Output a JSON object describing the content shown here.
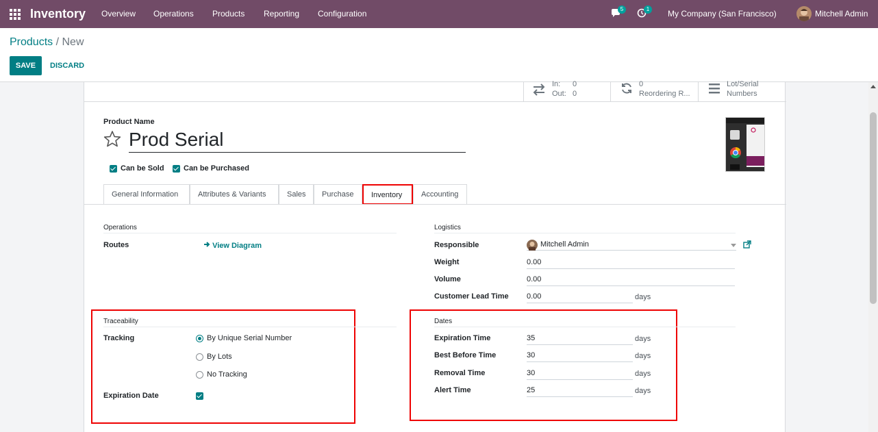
{
  "navbar": {
    "app_name": "Inventory",
    "menu": [
      "Overview",
      "Operations",
      "Products",
      "Reporting",
      "Configuration"
    ],
    "messages_count": "5",
    "activities_count": "1",
    "company": "My Company (San Francisco)",
    "user": "Mitchell Admin",
    "color": "#714b67"
  },
  "breadcrumb": {
    "parent": "Products",
    "separator": "/",
    "current": "New"
  },
  "buttons": {
    "save": "SAVE",
    "discard": "DISCARD"
  },
  "smart_buttons": {
    "in_label": "In:",
    "in_value": "0",
    "out_label": "Out:",
    "out_value": "0",
    "reordering_value": "0",
    "reordering_label": "Reordering R...",
    "lot_label_1": "Lot/Serial",
    "lot_label_2": "Numbers"
  },
  "product": {
    "name_label": "Product Name",
    "name": "Prod Serial",
    "can_be_sold": "Can be Sold",
    "can_be_purchased": "Can be Purchased"
  },
  "tabs": [
    "General Information",
    "Attributes & Variants",
    "Sales",
    "Purchase",
    "Inventory",
    "Accounting"
  ],
  "active_tab": "Inventory",
  "operations": {
    "title": "Operations",
    "routes_label": "Routes",
    "view_diagram": "View Diagram"
  },
  "logistics": {
    "title": "Logistics",
    "responsible_label": "Responsible",
    "responsible_value": "Mitchell Admin",
    "weight_label": "Weight",
    "weight_value": "0.00",
    "volume_label": "Volume",
    "volume_value": "0.00",
    "lead_label": "Customer Lead Time",
    "lead_value": "0.00",
    "lead_unit": "days"
  },
  "traceability": {
    "title": "Traceability",
    "tracking_label": "Tracking",
    "options": [
      "By Unique Serial Number",
      "By Lots",
      "No Tracking"
    ],
    "selected": "By Unique Serial Number",
    "expiration_label": "Expiration Date"
  },
  "dates": {
    "title": "Dates",
    "rows": [
      {
        "label": "Expiration Time",
        "value": "35",
        "unit": "days"
      },
      {
        "label": "Best Before Time",
        "value": "30",
        "unit": "days"
      },
      {
        "label": "Removal Time",
        "value": "30",
        "unit": "days"
      },
      {
        "label": "Alert Time",
        "value": "25",
        "unit": "days"
      }
    ]
  },
  "colors": {
    "accent": "#017e84",
    "highlight": "#ee0000"
  }
}
